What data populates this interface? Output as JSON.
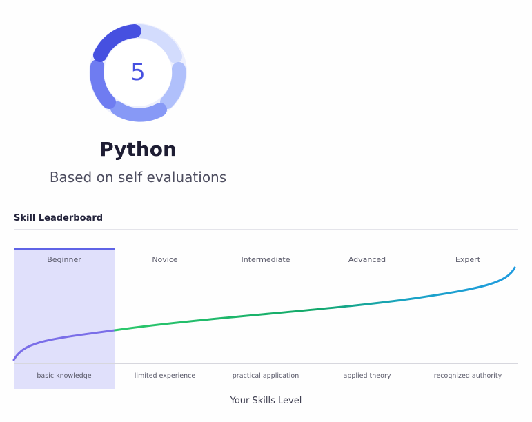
{
  "summary": {
    "score": "5",
    "skill_name": "Python",
    "subtitle": "Based on self evaluations"
  },
  "leaderboard": {
    "title": "Skill Leaderboard",
    "selected_level": "Beginner",
    "levels": [
      {
        "label": "Beginner",
        "description": "basic knowledge"
      },
      {
        "label": "Novice",
        "description": "limited experience"
      },
      {
        "label": "Intermediate",
        "description": "practical application"
      },
      {
        "label": "Advanced",
        "description": "applied theory"
      },
      {
        "label": "Expert",
        "description": "recognized authority"
      }
    ],
    "axis_title": "Your Skills Level"
  },
  "colors": {
    "accent": "#4650e0",
    "highlight": "#e0e0fb",
    "curve_purple": "#7a6ee8",
    "curve_green": "#27c36a",
    "curve_blue": "#1f9be0"
  }
}
